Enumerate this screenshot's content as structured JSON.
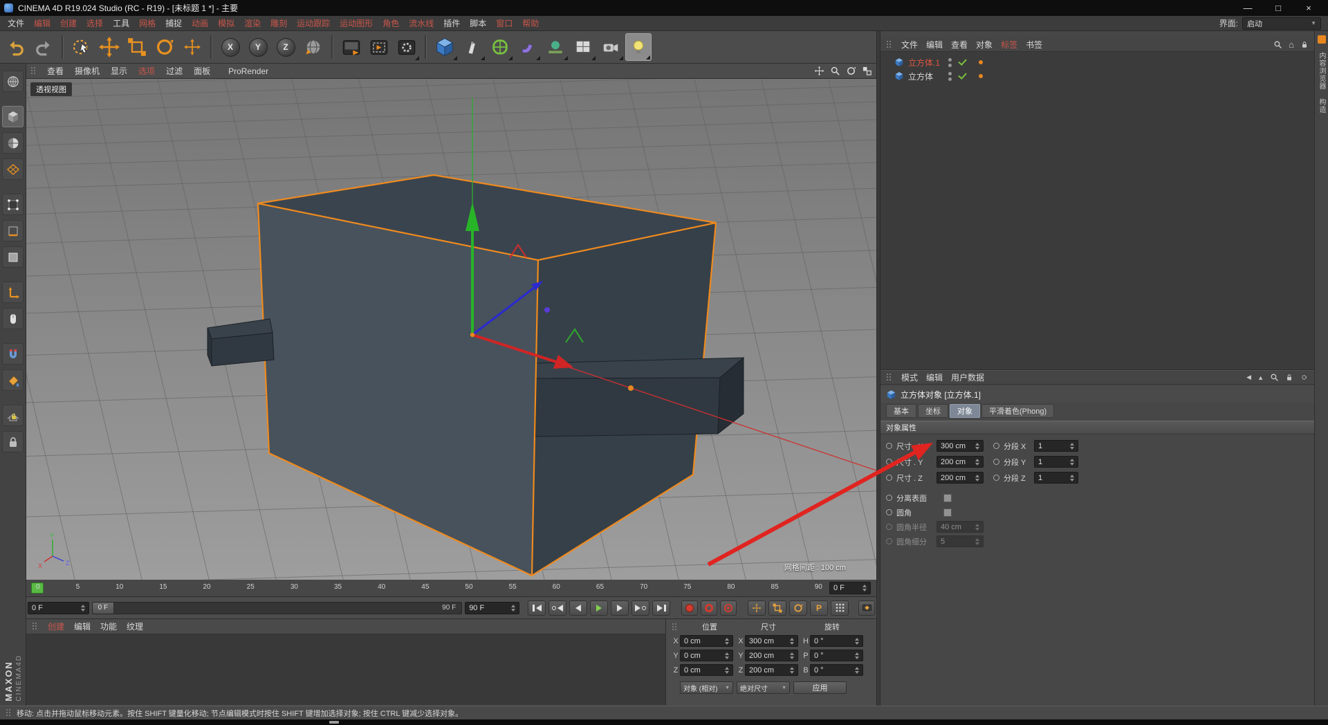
{
  "window": {
    "title": "CINEMA 4D R19.024 Studio (RC - R19) - [未标题 1 *] - 主要",
    "minimize": "—",
    "maximize": "□",
    "close": "×"
  },
  "menubar": {
    "items": [
      "文件",
      "编辑",
      "创建",
      "选择",
      "工具",
      "网格",
      "捕捉",
      "动画",
      "模拟",
      "渲染",
      "雕刻",
      "运动跟踪",
      "运动图形",
      "角色",
      "流水线",
      "插件",
      "脚本",
      "窗口",
      "帮助"
    ],
    "interface_label": "界面:",
    "interface_value": "启动"
  },
  "toolbar": {
    "axis": [
      "X",
      "Y",
      "Z"
    ]
  },
  "viewport": {
    "menu": [
      "查看",
      "摄像机",
      "显示",
      "选项",
      "过滤",
      "面板",
      "ProRender"
    ],
    "label": "透视视图",
    "grid_spacing": "网格间距 : 100 cm",
    "axis_x": "X",
    "axis_y": "Y",
    "axis_z": "Z"
  },
  "object_manager": {
    "menu": [
      "文件",
      "编辑",
      "查看",
      "对象",
      "标签",
      "书签"
    ],
    "objects": [
      {
        "name": "立方体.1"
      },
      {
        "name": "立方体"
      }
    ]
  },
  "attributes": {
    "menu": [
      "模式",
      "编辑",
      "用户数据"
    ],
    "title": "立方体对象 [立方体.1]",
    "tabs": [
      "基本",
      "坐标",
      "对象",
      "平滑着色(Phong)"
    ],
    "section": "对象属性",
    "rows": [
      {
        "label": "尺寸 . X",
        "value": "300 cm",
        "label2": "分段 X",
        "value2": "1"
      },
      {
        "label": "尺寸 . Y",
        "value": "200 cm",
        "label2": "分段 Y",
        "value2": "1"
      },
      {
        "label": "尺寸 . Z",
        "value": "200 cm",
        "label2": "分段 Z",
        "value2": "1"
      }
    ],
    "checks": [
      {
        "label": "分离表面"
      },
      {
        "label": "圆角"
      }
    ],
    "disabled": [
      {
        "label": "圆角半径",
        "value": "40 cm"
      },
      {
        "label": "圆角细分",
        "value": "5"
      }
    ]
  },
  "timeline": {
    "ticks": [
      "0",
      "5",
      "10",
      "15",
      "20",
      "25",
      "30",
      "35",
      "40",
      "45",
      "50",
      "55",
      "60",
      "65",
      "70",
      "75",
      "80",
      "85",
      "90"
    ],
    "end_box": "0 F"
  },
  "transport": {
    "frame": "0 F",
    "slider_start": "0 F",
    "slider_end": "90 F",
    "end_frame": "90 F",
    "param": "P"
  },
  "materials": {
    "menu": [
      "创建",
      "编辑",
      "功能",
      "纹理"
    ]
  },
  "coordinates": {
    "headers": [
      "位置",
      "尺寸",
      "旋转"
    ],
    "rows": [
      {
        "pl": "X",
        "pv": "0 cm",
        "sl": "X",
        "sv": "300 cm",
        "rl": "H",
        "rv": "0 °"
      },
      {
        "pl": "Y",
        "pv": "0 cm",
        "sl": "Y",
        "sv": "200 cm",
        "rl": "P",
        "rv": "0 °"
      },
      {
        "pl": "Z",
        "pv": "0 cm",
        "sl": "Z",
        "sv": "200 cm",
        "rl": "B",
        "rv": "0 °"
      }
    ],
    "mode_object": "对象 (相对)",
    "mode_size": "绝对尺寸",
    "apply": "应用"
  },
  "statusbar": {
    "text": "移动: 点击并拖动鼠标移动元素。按住 SHIFT 键量化移动; 节点编辑模式时按住 SHIFT 键增加选择对象; 按住 CTRL 键减少选择对象。"
  },
  "branding": {
    "maxon": "MAXON",
    "cinema": "CINEMA4D"
  },
  "side_tabs": [
    "内容浏览器",
    "构造"
  ],
  "colors": {
    "accent_orange": "#e8871f",
    "selected_object_red": "#e05540",
    "axis_x_red": "#d02525",
    "axis_y_green": "#28b428",
    "axis_z_blue": "#2a2ad0",
    "annotation_red": "#e02420",
    "object_icon_blue": "#3b79c4",
    "playhead_green": "#5ab945"
  }
}
